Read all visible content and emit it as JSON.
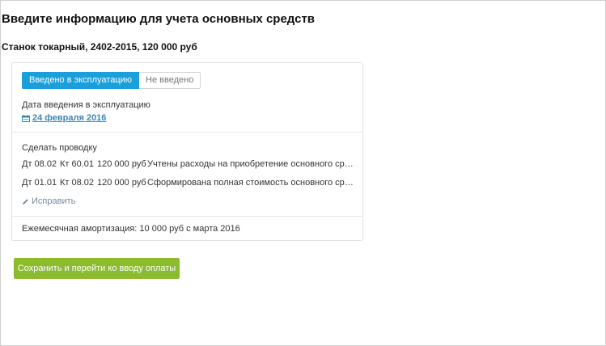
{
  "page": {
    "title": "Введите информацию для учета основных средств",
    "asset_title": "Станок токарный, 2402-2015, 120 000 руб"
  },
  "commissioning": {
    "toggle_active": "Введено в эксплуатацию",
    "toggle_inactive": "Не введено",
    "date_label": "Дата введения в эксплуатацию",
    "date_value": "24 февраля 2016"
  },
  "posting": {
    "label": "Сделать проводку",
    "entries": [
      {
        "debit": "Дт 08.02",
        "credit": "Кт 60.01",
        "amount": "120 000 руб",
        "description": "Учтены расходы на приобретение основного сред..."
      },
      {
        "debit": "Дт 01.01",
        "credit": "Кт 08.02",
        "amount": "120 000 руб",
        "description": "Сформирована полная стоимость основного сред..."
      }
    ],
    "edit_label": "Исправить"
  },
  "amortization": {
    "text": "Ежемесячная амортизация: 10 000 руб с марта 2016"
  },
  "actions": {
    "save_label": "Сохранить и перейти ко вводу оплаты"
  },
  "colors": {
    "accent_blue": "#1a9fdb",
    "link_blue": "#3f84b5",
    "save_green": "#8dbb2e"
  },
  "icons": {
    "date": "calendar-icon",
    "edit": "pencil-icon"
  }
}
